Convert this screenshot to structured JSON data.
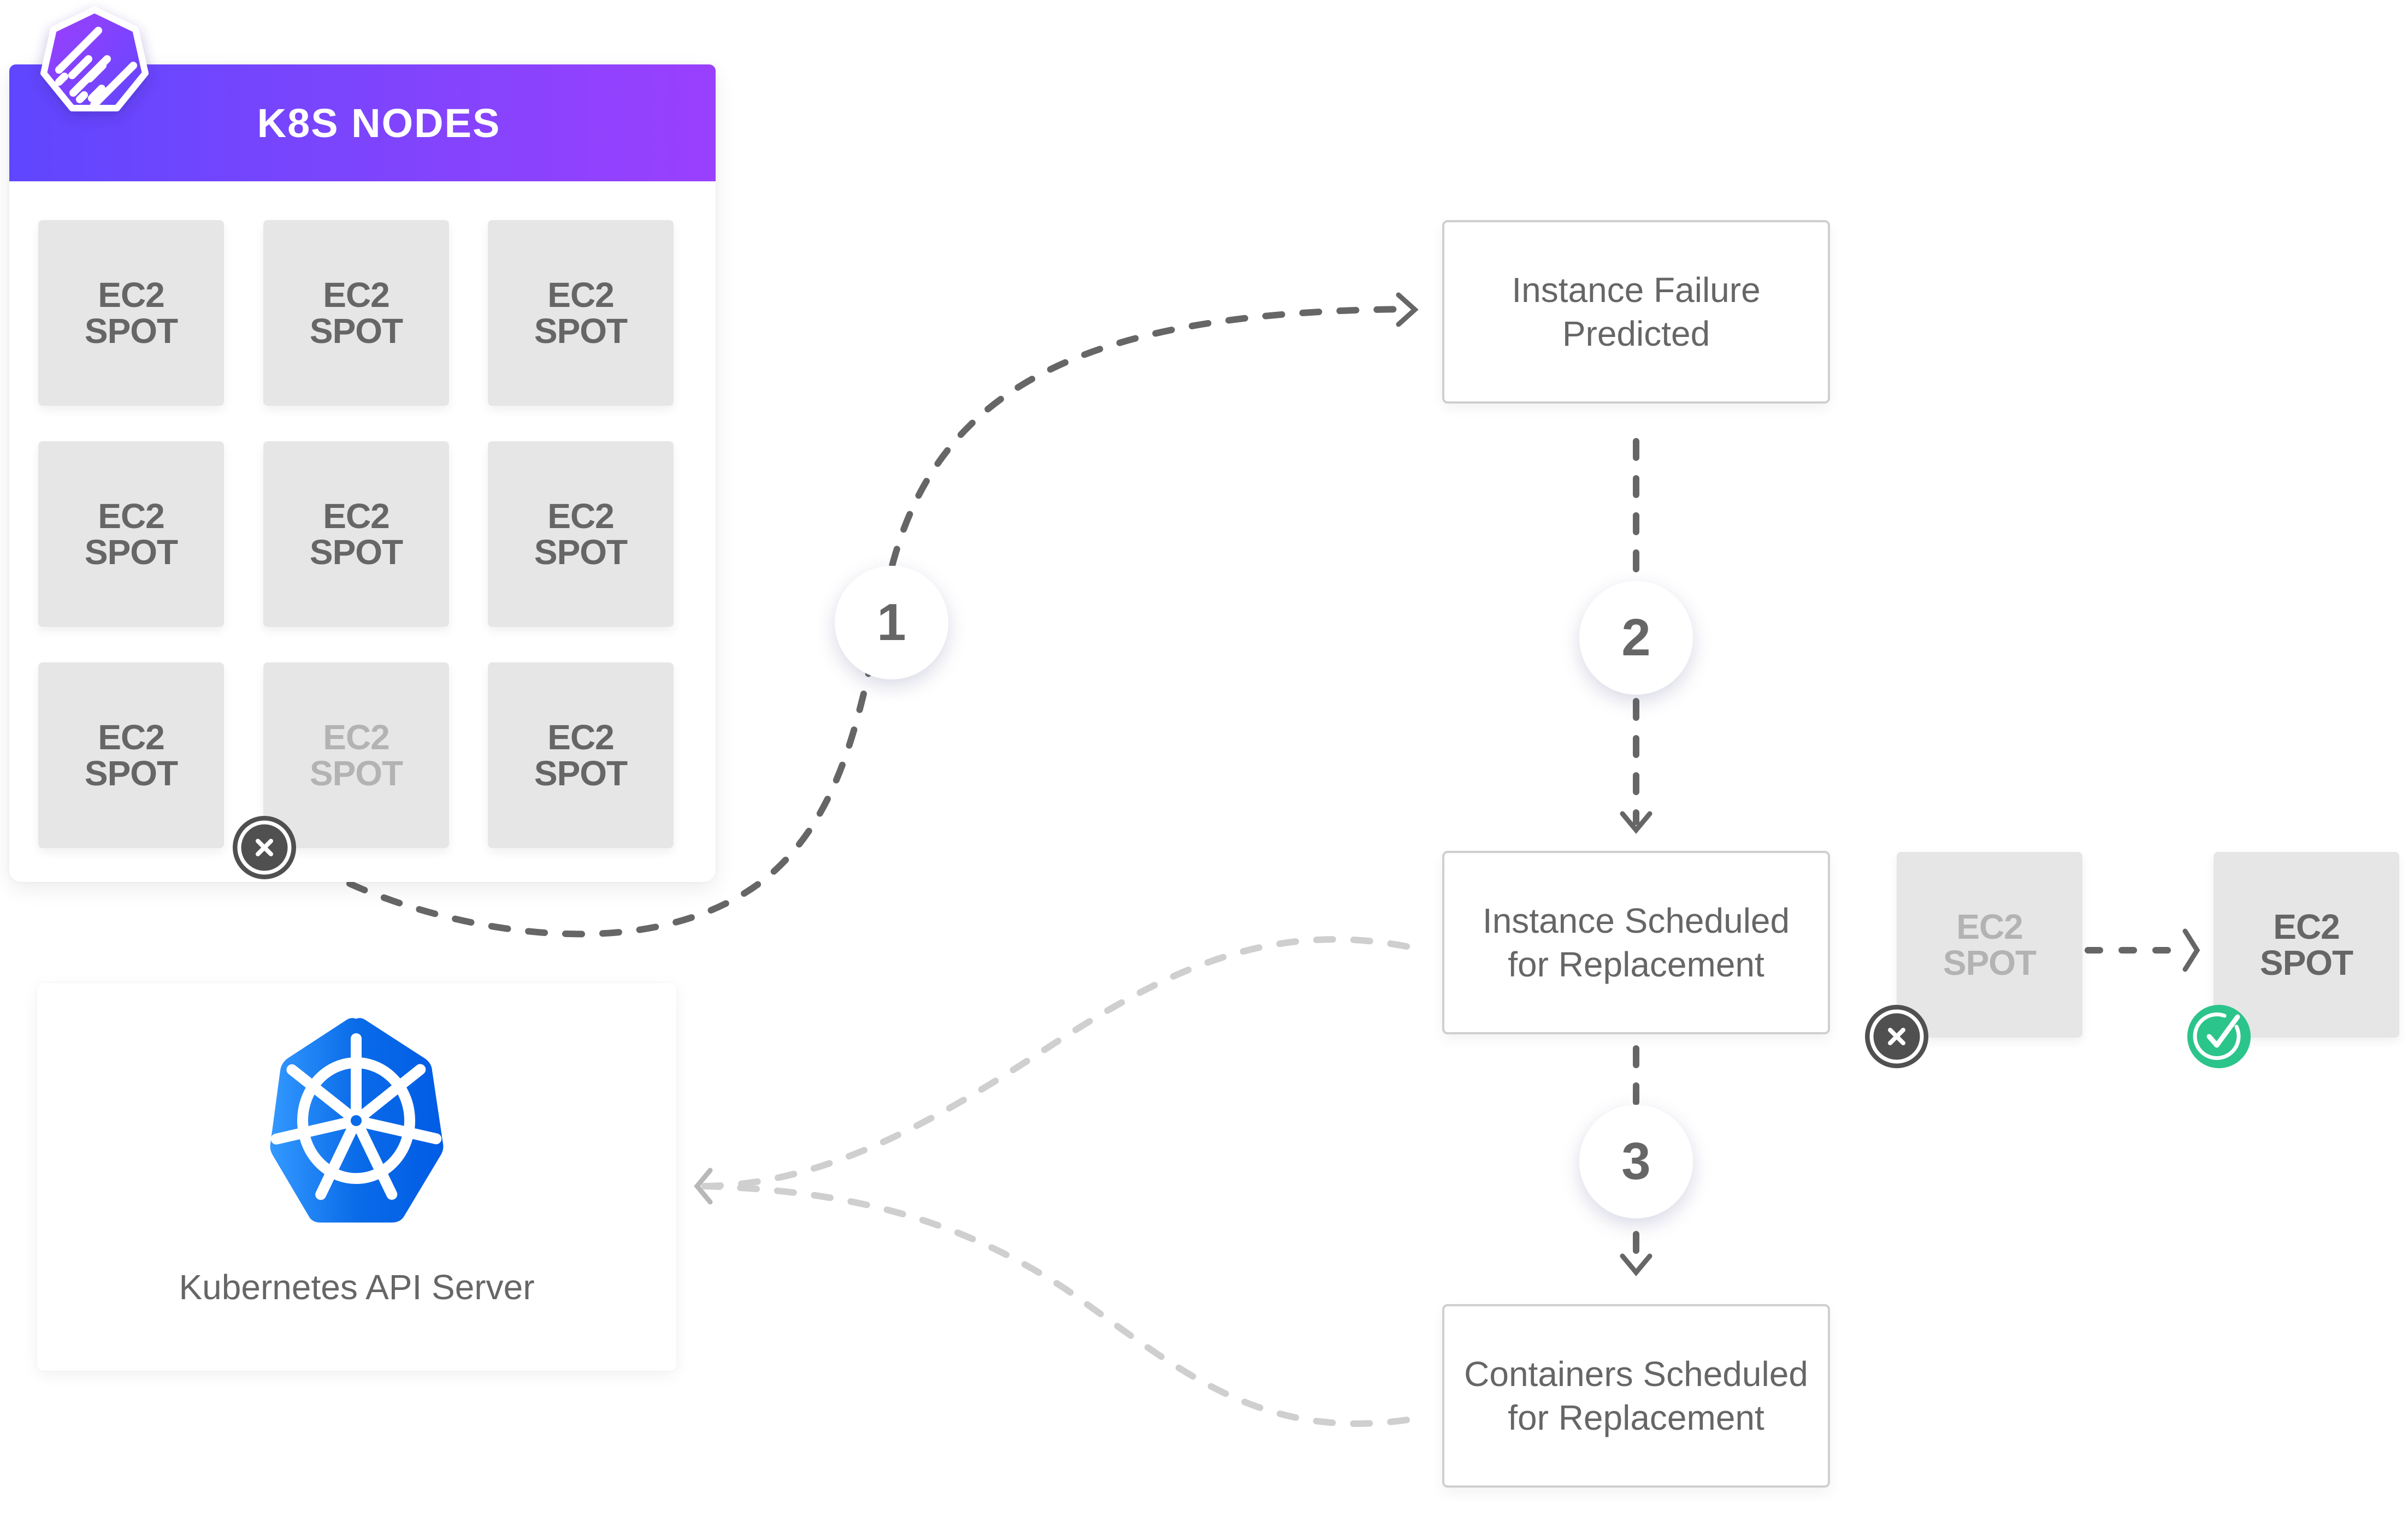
{
  "colors": {
    "header_gradient_start": "#5f46fe",
    "header_gradient_end": "#9a40fd",
    "tile_bg": "#e6e6e6",
    "tile_text": "#666666",
    "tile_text_faded": "#b3b3b3",
    "connector_dark": "#666666",
    "connector_light": "#cfcfcf",
    "error_badge": "#505050",
    "success_badge": "#2bc48a",
    "k8s_blue_light": "#3399ff",
    "k8s_blue_dark": "#005ce6"
  },
  "nodes_panel": {
    "title": "K8S NODES",
    "logo_icon": "brand-hexagon-logo",
    "tiles": [
      {
        "line1": "EC2",
        "line2": "SPOT",
        "state": "active"
      },
      {
        "line1": "EC2",
        "line2": "SPOT",
        "state": "active"
      },
      {
        "line1": "EC2",
        "line2": "SPOT",
        "state": "active"
      },
      {
        "line1": "EC2",
        "line2": "SPOT",
        "state": "active"
      },
      {
        "line1": "EC2",
        "line2": "SPOT",
        "state": "active"
      },
      {
        "line1": "EC2",
        "line2": "SPOT",
        "state": "active"
      },
      {
        "line1": "EC2",
        "line2": "SPOT",
        "state": "active"
      },
      {
        "line1": "EC2",
        "line2": "SPOT",
        "state": "failed"
      },
      {
        "line1": "EC2",
        "line2": "SPOT",
        "state": "active"
      }
    ],
    "failed_badge_icon": "close-circle-icon"
  },
  "api_server": {
    "label": "Kubernetes API Server",
    "icon": "kubernetes-helm-icon"
  },
  "steps": [
    {
      "number": "1"
    },
    {
      "number": "2"
    },
    {
      "number": "3"
    }
  ],
  "step_boxes": [
    {
      "line1": "Instance Failure",
      "line2": "Predicted"
    },
    {
      "line1": "Instance Scheduled",
      "line2": "for Replacement"
    },
    {
      "line1": "Containers Scheduled",
      "line2": "for Replacement"
    }
  ],
  "replacement": {
    "old_tile": {
      "line1": "EC2",
      "line2": "SPOT",
      "state": "failed",
      "badge_icon": "close-circle-icon"
    },
    "new_tile": {
      "line1": "EC2",
      "line2": "SPOT",
      "state": "active",
      "badge_icon": "check-circle-icon"
    }
  }
}
